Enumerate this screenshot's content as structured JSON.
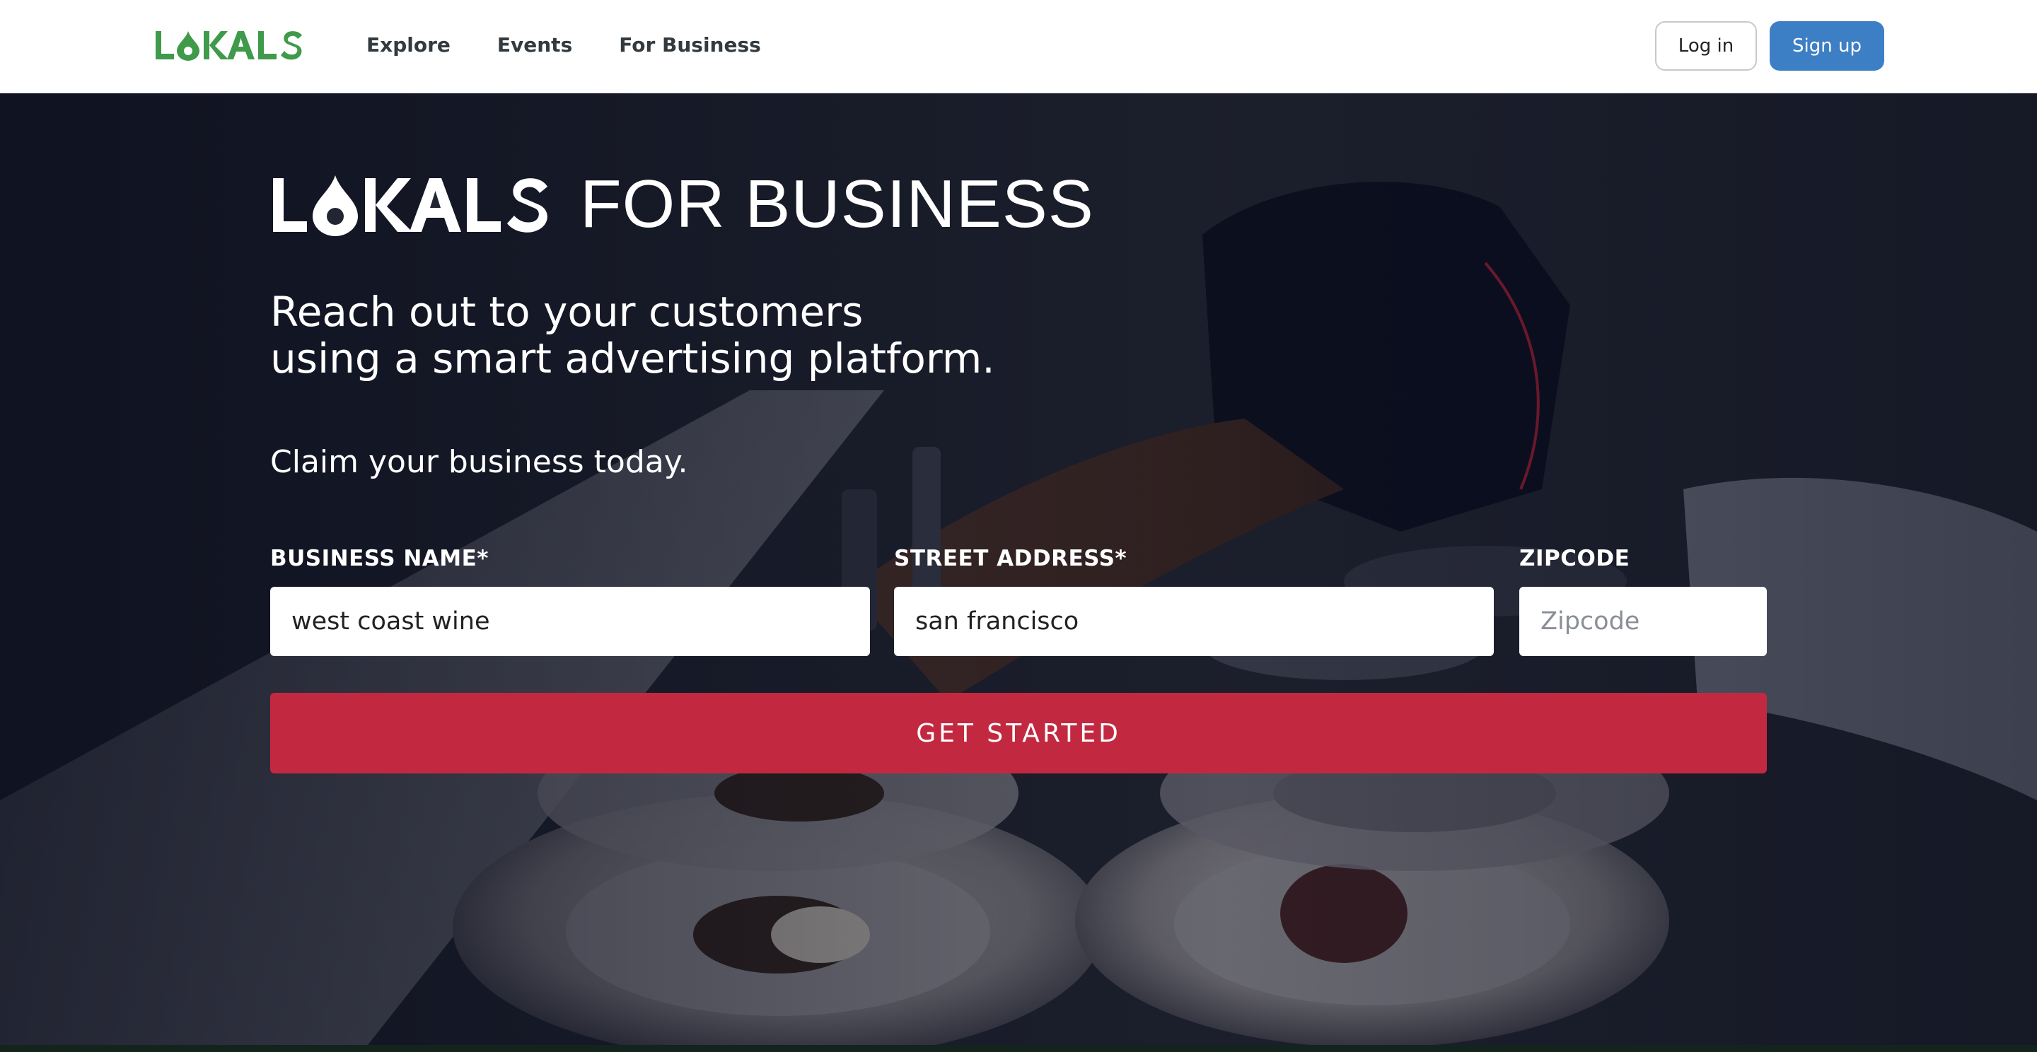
{
  "nav": {
    "logo_text": "LOKALS",
    "links": [
      "Explore",
      "Events",
      "For Business"
    ],
    "login_label": "Log in",
    "signup_label": "Sign up"
  },
  "hero": {
    "logo_text": "LOKALS",
    "title": "FOR BUSINESS",
    "tagline_line1": "Reach out to your customers",
    "tagline_line2": "using a smart advertising platform.",
    "claim": "Claim your business today."
  },
  "form": {
    "business_name": {
      "label": "BUSINESS NAME*",
      "value": "west coast wine",
      "placeholder": ""
    },
    "street_address": {
      "label": "STREET ADDRESS*",
      "value": "san francisco",
      "placeholder": ""
    },
    "zipcode": {
      "label": "ZIPCODE",
      "value": "",
      "placeholder": "Zipcode"
    },
    "submit_label": "GET STARTED"
  },
  "colors": {
    "brand_green": "#3f9a4a",
    "primary_blue": "#3d7fc4",
    "cta_red": "#c22940",
    "hero_overlay": "#0b1020"
  },
  "icons": {
    "logo_mark": "flame-drop-icon"
  }
}
